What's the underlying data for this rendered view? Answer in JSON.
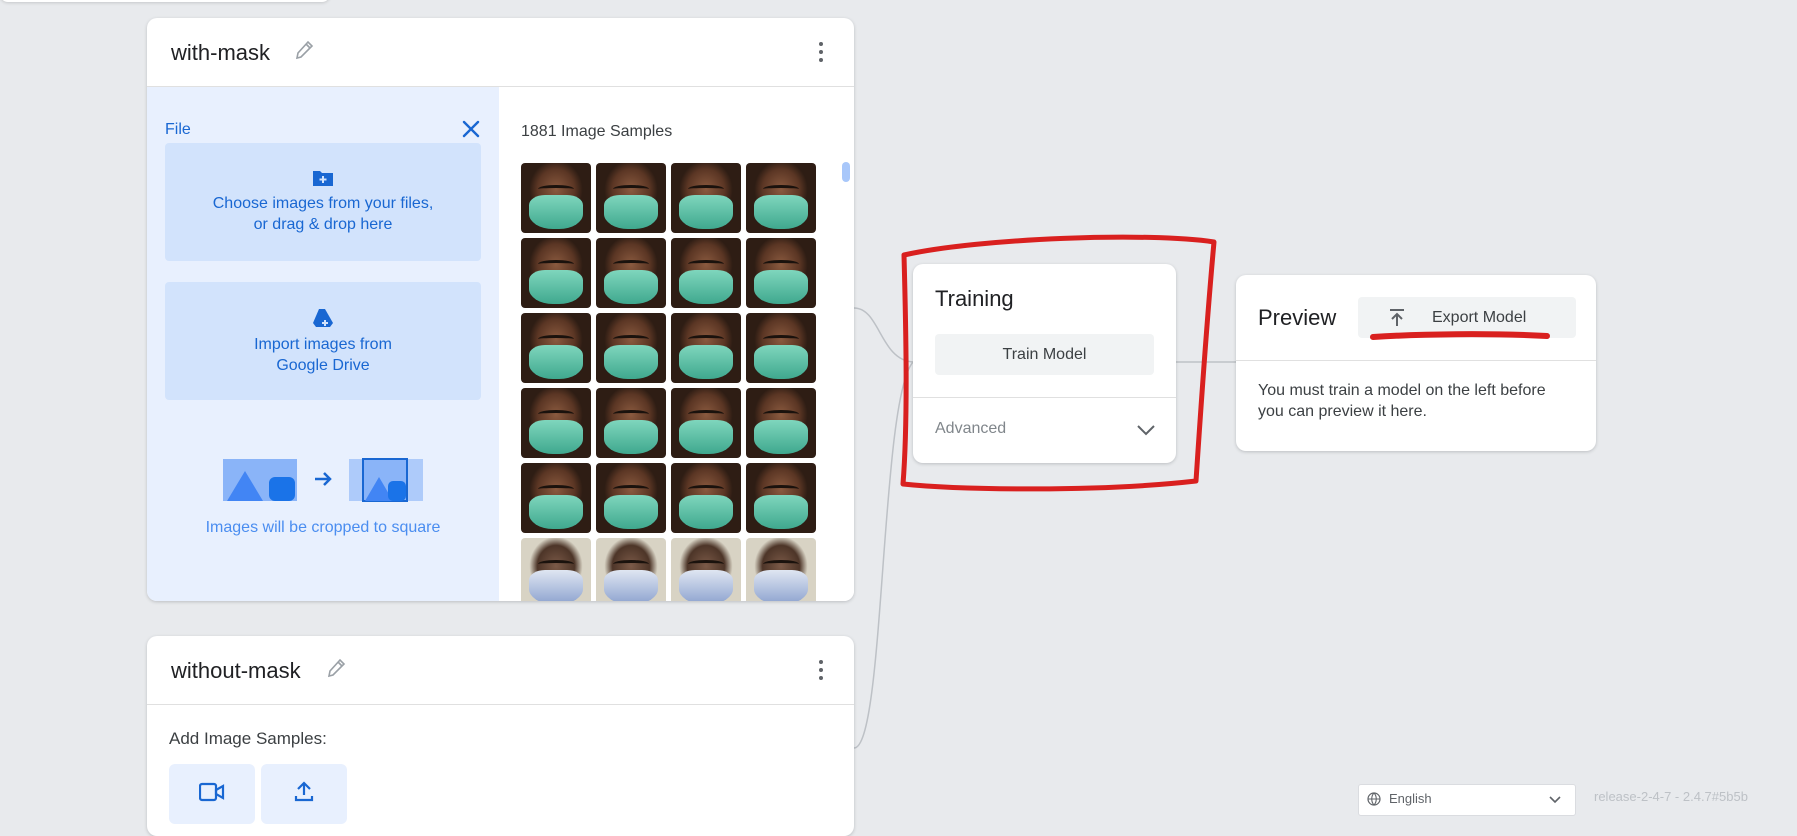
{
  "classes": [
    {
      "name": "with-mask",
      "upload": {
        "source_label": "File",
        "choose_files": "Choose images from your files, or drag & drop here",
        "choose_files_line1": "Choose images from your files,",
        "choose_files_line2": "or drag & drop here",
        "drive_line1": "Import images from",
        "drive_line2": "Google Drive",
        "crop_note": "Images will be cropped to square"
      },
      "samples_count": "1881 Image Samples",
      "thumbnail_rows": [
        [
          "green-mask",
          "green-mask",
          "green-mask",
          "green-mask"
        ],
        [
          "green-mask",
          "green-mask",
          "green-mask",
          "green-mask"
        ],
        [
          "green-mask",
          "green-mask",
          "green-mask",
          "green-mask"
        ],
        [
          "green-mask",
          "green-mask",
          "green-mask",
          "green-mask"
        ],
        [
          "green-mask",
          "green-mask",
          "green-mask",
          "green-mask"
        ],
        [
          "blue-mask",
          "blue-mask",
          "blue-mask",
          "blue-mask"
        ]
      ]
    },
    {
      "name": "without-mask",
      "add_samples_label": "Add Image Samples:",
      "sources": [
        {
          "icon": "webcam-icon"
        },
        {
          "icon": "upload-icon"
        }
      ]
    }
  ],
  "training": {
    "title": "Training",
    "train_button": "Train Model",
    "advanced_label": "Advanced"
  },
  "preview": {
    "title": "Preview",
    "export_button": "Export Model",
    "message": "You must train a model on the left before you can preview it here."
  },
  "footer": {
    "language": "English",
    "release": "release-2-4-7 - 2.4.7#5b5b"
  },
  "annotations": {
    "color": "#d9201f"
  },
  "colors": {
    "accent_blue": "#1967d2",
    "panel_blue": "#e8f0fe",
    "box_blue": "#d2e3fc",
    "background": "#e8eaed"
  }
}
